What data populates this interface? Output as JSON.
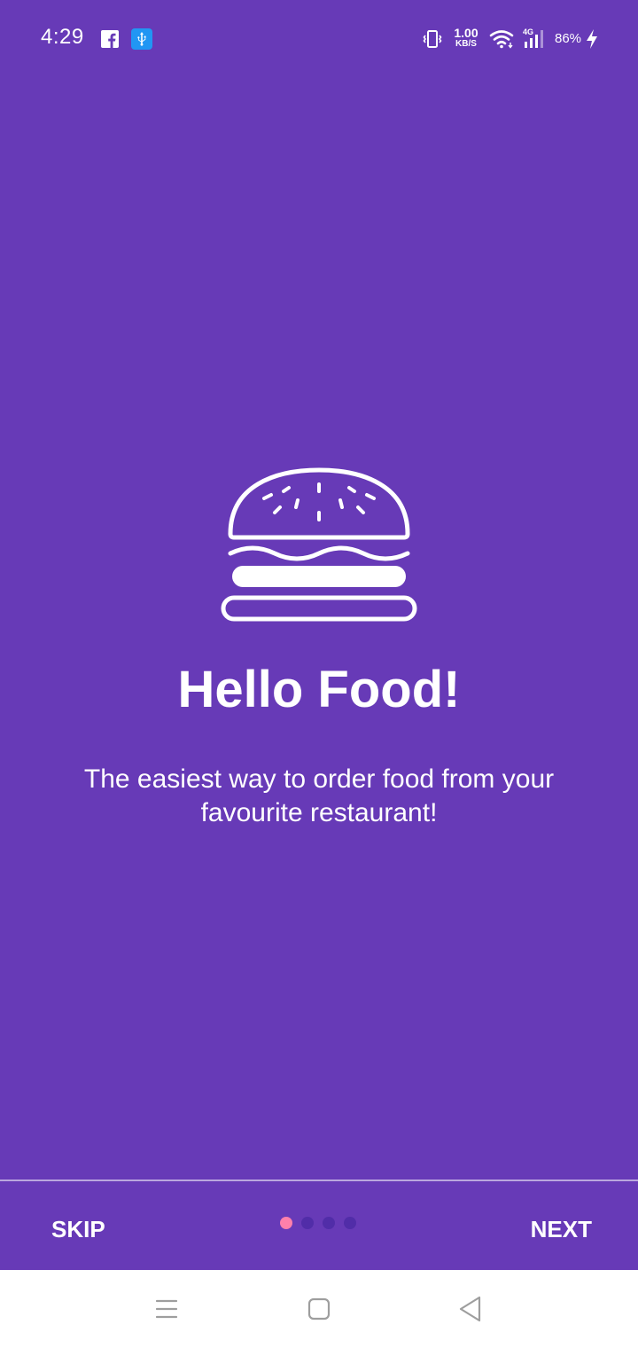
{
  "status_bar": {
    "time": "4:29",
    "net_speed_value": "1.00",
    "net_speed_unit": "KB/S",
    "network_type": "4G",
    "battery": "86%",
    "icons": [
      "facebook-icon",
      "usb-icon",
      "vibrate-icon",
      "wifi-icon",
      "signal-icon",
      "charging-icon"
    ]
  },
  "onboarding": {
    "icon": "burger-icon",
    "title": "Hello Food!",
    "subtitle": "The easiest way to order food from your favourite restaurant!",
    "page_count": 4,
    "active_page": 1
  },
  "footer": {
    "skip_label": "SKIP",
    "next_label": "NEXT"
  },
  "system_nav": {
    "icons": [
      "menu-icon",
      "home-icon",
      "back-icon"
    ]
  },
  "colors": {
    "background": "#673ab7",
    "dot_active": "#ff80ab",
    "dot_inactive": "#512da8",
    "nav_bar": "#ffffff",
    "nav_icons": "#9e9e9e"
  }
}
